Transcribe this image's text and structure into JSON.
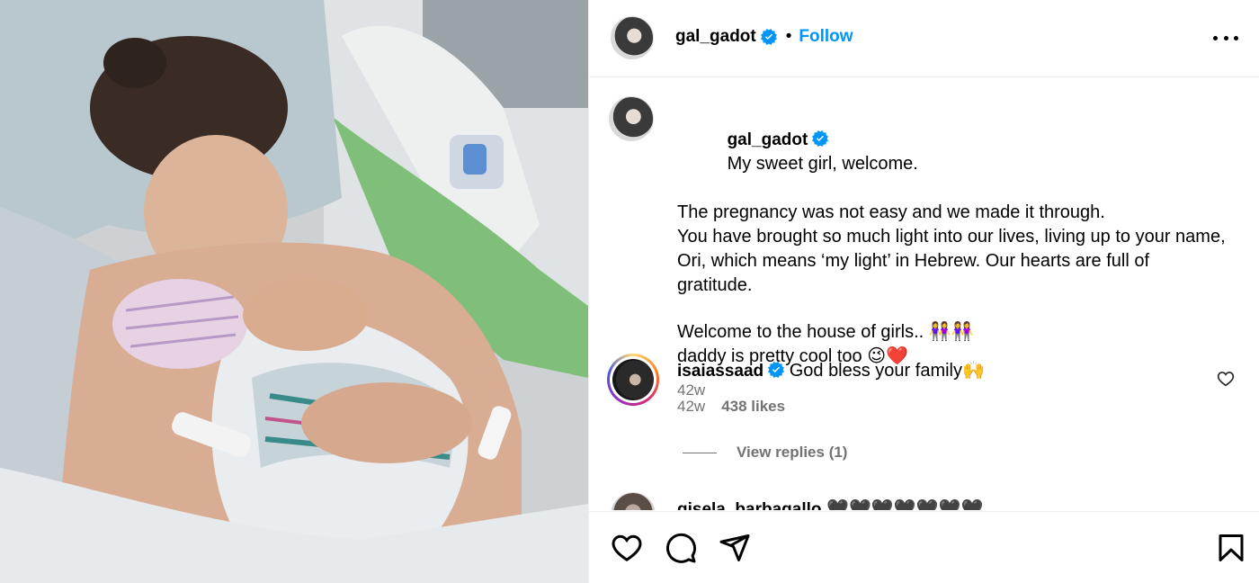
{
  "post": {
    "username": "gal_gadot",
    "follow_label": "Follow",
    "separator": "•",
    "caption_lines": [
      "My sweet girl, welcome.",
      "The pregnancy was not easy and we made it through.",
      "You have brought so much light into our lives, living up to your name, Ori, which means ‘my light’ in Hebrew. Our hearts are full of gratitude.",
      "",
      "Welcome to the house of girls.. 👭👭",
      "daddy is pretty cool too 😉❤️"
    ],
    "caption_time": "42w"
  },
  "comments": [
    {
      "username": "isaiassaad",
      "text": "God bless your family🙌",
      "time": "42w",
      "likes": "438 likes",
      "view_replies": "View replies (1)"
    },
    {
      "username": "gisela_barbagallo",
      "text": "🖤🖤🖤🖤🖤🖤🖤"
    }
  ],
  "icons": {
    "verified": "verified-badge-icon",
    "more": "more-options-icon",
    "like": "heart-icon",
    "comment": "comment-icon",
    "share": "share-icon",
    "save": "bookmark-icon"
  },
  "colors": {
    "accent": "#0095f6",
    "muted": "#737373",
    "border": "#efefef"
  }
}
